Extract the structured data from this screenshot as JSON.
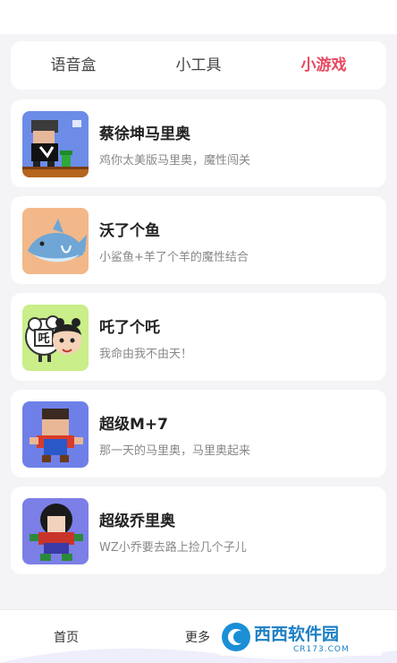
{
  "tabs": [
    {
      "label": "语音盒"
    },
    {
      "label": "小工具"
    },
    {
      "label": "小游戏"
    }
  ],
  "active_tab_color": "#e8475f",
  "games": [
    {
      "title": "蔡徐坤马里奥",
      "desc": "鸡你太美版马里奥，魔性闯关"
    },
    {
      "title": "沃了个鱼",
      "desc": "小鲨鱼+羊了个羊的魔性结合"
    },
    {
      "title": "吒了个吒",
      "desc": "我命由我不由天！"
    },
    {
      "title": "超级M+7",
      "desc": "那一天的马里奥，马里奥起来"
    },
    {
      "title": "超级乔里奥",
      "desc": "WZ小乔要去路上捡几个子儿"
    }
  ],
  "bottom_nav": {
    "home": "首页",
    "more": "更多"
  },
  "watermark": {
    "brand": "西西软件园",
    "site": "CR173.COM"
  }
}
